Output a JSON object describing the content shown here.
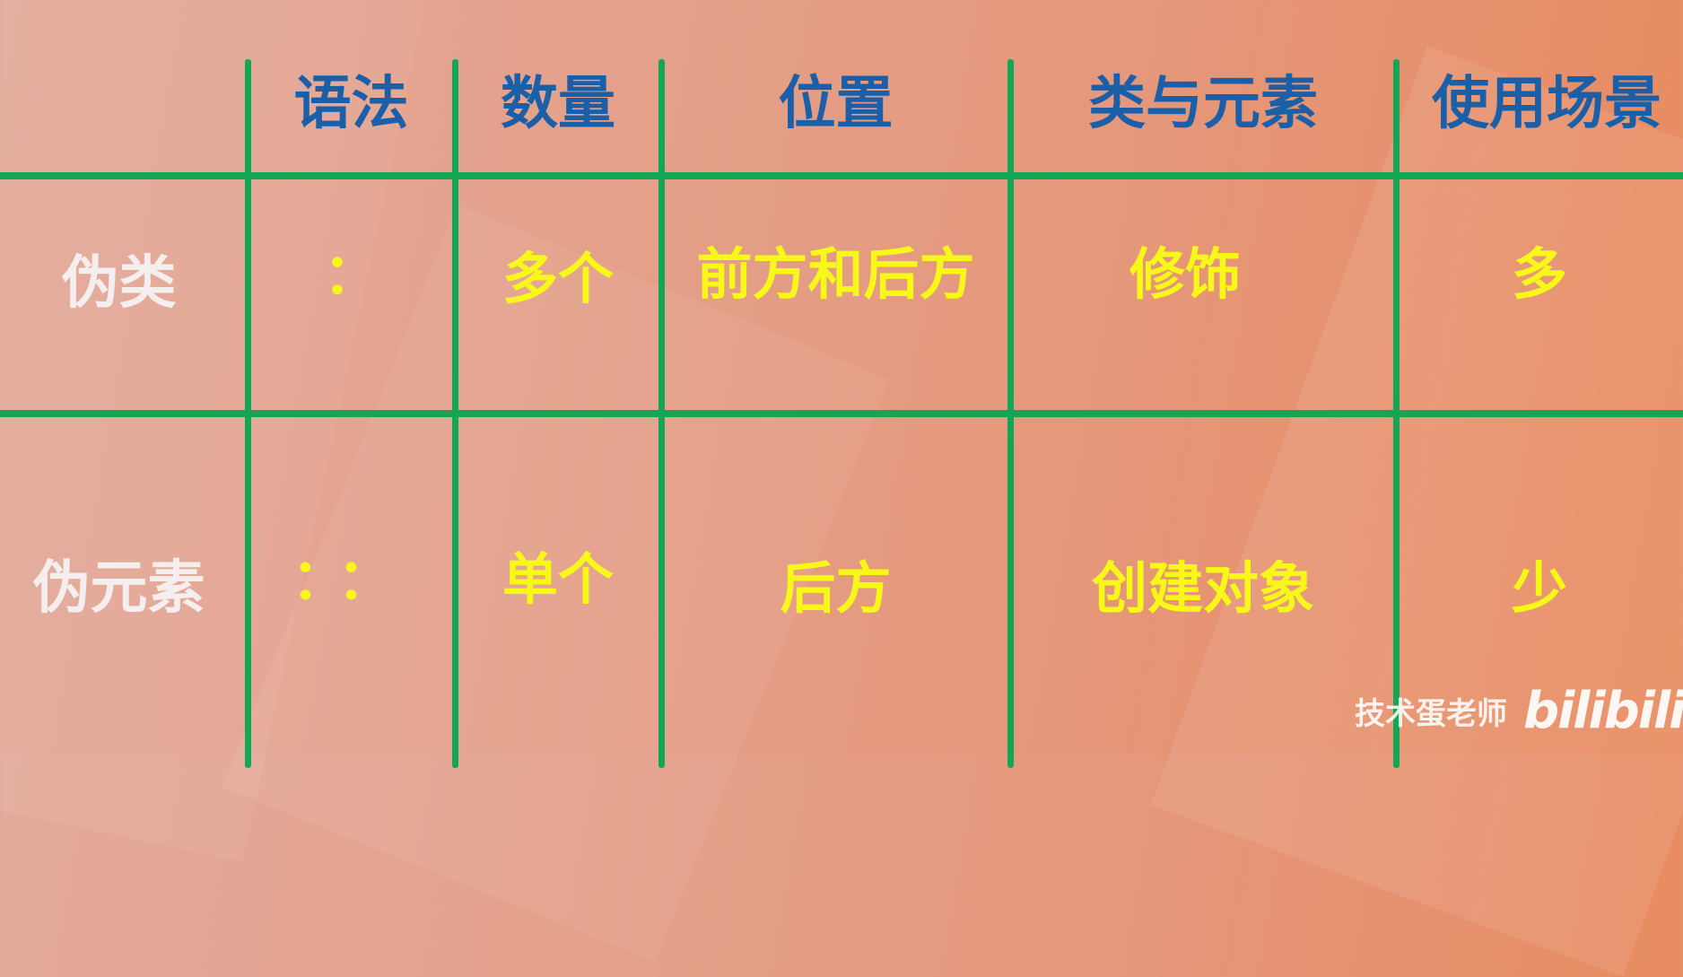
{
  "table": {
    "columns": [
      "语法",
      "数量",
      "位置",
      "类与元素",
      "使用场景"
    ],
    "rows": [
      {
        "label": "伪类",
        "cells": [
          "：",
          "多个",
          "前方和后方",
          "修饰",
          "多"
        ]
      },
      {
        "label": "伪元素",
        "cells": [
          "：：",
          "单个",
          "后方",
          "创建对象",
          "少"
        ]
      }
    ]
  },
  "watermark": {
    "author": "技术蛋老师",
    "logo_text": "bilibili"
  },
  "colors": {
    "grid": "#13a655",
    "header_text": "#1a5fa8",
    "row_label_text": "#f4efee",
    "value_text": "#f8f818"
  }
}
